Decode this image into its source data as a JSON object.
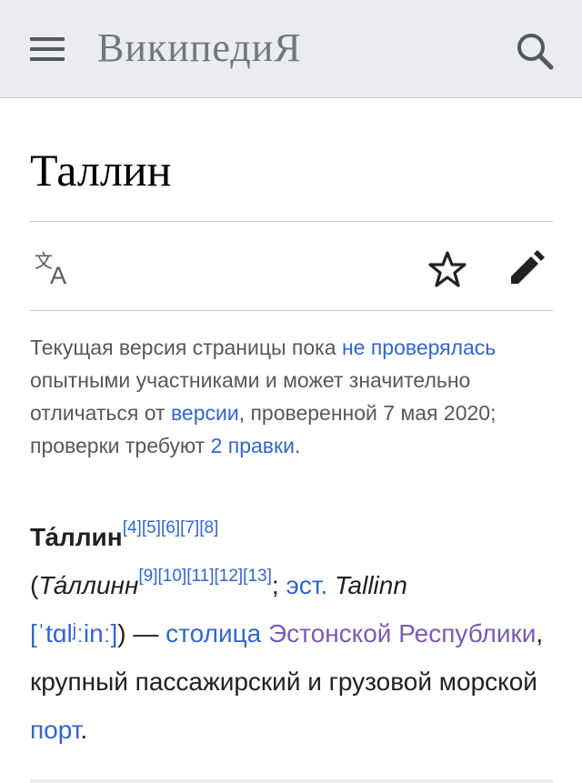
{
  "header": {
    "logo_text": "ВикипедиЯ",
    "menu_icon": "hamburger-menu-icon",
    "search_icon": "search-icon"
  },
  "page": {
    "title": "Таллин"
  },
  "actions": {
    "language_icon": "language-icon",
    "watch_icon": "star-icon",
    "edit_icon": "pencil-icon"
  },
  "notice": {
    "part1": "Текущая версия страницы пока ",
    "link1": "не проверялась",
    "part2": " опытными участниками и может значительно отличаться от ",
    "link2": "версии",
    "part3": ", проверенной 7 мая 2020; проверки требуют ",
    "link3": "2 правки",
    "part4": "."
  },
  "article": {
    "term": "Та́ллин",
    "refs1": [
      "[4]",
      "[5]",
      "[6]",
      "[7]",
      "[8]"
    ],
    "open_paren": "(",
    "alt_name": "Та́ллинн",
    "refs2": [
      "[9]",
      "[10]",
      "[11]",
      "[12]",
      "[13]"
    ],
    "semicolon": "; ",
    "lang_link": "эст.",
    "est_name": " Tallinn",
    "space": " ",
    "ipa": "[ˈtɑlʲːinː]",
    "dash": ") — ",
    "capital_link": "столица",
    "space2": " ",
    "republic_link": "Эстонской Республики",
    "text_mid": ", крупный пассажирский и грузовой морской ",
    "port_link": "порт",
    "text_end": "."
  },
  "colors": {
    "header_bg": "#eaecf0",
    "link": "#3366cc",
    "visited_link": "#795cb2",
    "text": "#202122",
    "muted": "#54595d",
    "icon": "#54595d"
  }
}
